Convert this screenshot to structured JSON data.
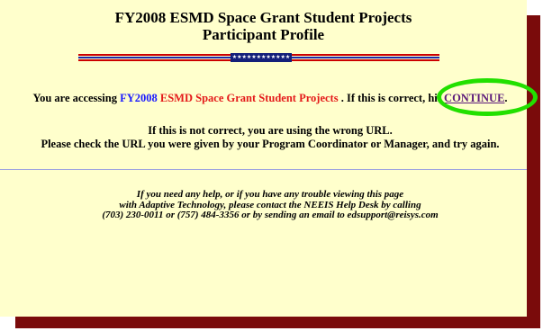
{
  "header": {
    "title_line1": "FY2008 ESMD Space Grant Student Projects",
    "title_line2": "Participant Profile"
  },
  "banner": {
    "stars_text": "★★★★★★★★★★★★"
  },
  "access": {
    "prefix": "You are accessing ",
    "fiscal_year": "FY2008",
    "program_name": "ESMD Space Grant Student Projects",
    "middle": " . If this is correct, hit ",
    "continue_label": "CONTINUE",
    "suffix": "."
  },
  "wrong_url": {
    "line1": "If this is not correct, you are using the wrong URL.",
    "line2": "Please check the URL you were given by your Program Coordinator or Manager, and try again."
  },
  "help": {
    "line1": "If you need any help, or if you have any trouble viewing this page",
    "line2": "with Adaptive Technology, please contact the NEEIS Help Desk by calling",
    "line3": "(703) 230-0011 or (757) 484-3356 or by sending an email to edsupport@reisys.com"
  },
  "colors": {
    "panel_background": "#ffffcc",
    "shadow": "#7a0b0b",
    "fiscal_year_text": "#1a1aff",
    "program_name_text": "#e41a1a",
    "link": "#5b1a7a",
    "highlight_ring": "#22e000"
  }
}
